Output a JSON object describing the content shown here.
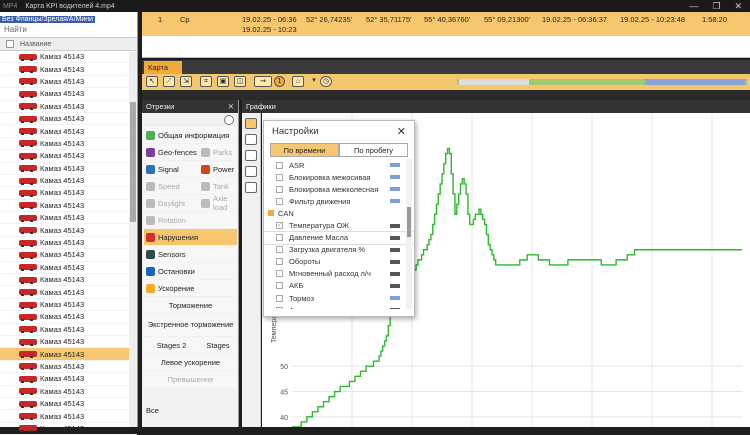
{
  "window": {
    "app": "MP4",
    "title": "Карта KPI водителей 4.mp4",
    "controls": [
      "—",
      "❐",
      "✕"
    ]
  },
  "vehicle_panel": {
    "overlay_text": "Без Фланцы/Зрелая/А/Мини",
    "search_placeholder": "Найти",
    "column_name": "Название",
    "rows": [
      "Камаз 45143",
      "Камаз 45143",
      "Камаз 45143",
      "Камаз 45143",
      "Камаз 45143",
      "Камаз 45143",
      "Камаз 45143",
      "Камаз 45143",
      "Камаз 45143",
      "Камаз 45143",
      "Камаз 45143",
      "Камаз 45143",
      "Камаз 45143",
      "Камаз 45143",
      "Камаз 45143",
      "Камаз 45143",
      "Камаз 45143",
      "Камаз 45143",
      "Камаз 45143",
      "Камаз 45143",
      "Камаз 45143",
      "Камаз 45143",
      "Камаз 45143",
      "Камаз 45143",
      "Камаз 45143",
      "Камаз 45143",
      "Камаз 45143",
      "Камаз 45143",
      "Камаз 45143",
      "Камаз 45143",
      "Камаз 45143"
    ],
    "selected_index": 24
  },
  "trip_row": {
    "number": "1",
    "type": "Ср",
    "period": "19.02.25 - 06:36",
    "period2": "19.02.25 - 10:23",
    "lat_start": "52° 26,74235'",
    "lat_end": "52° 35,71175'",
    "lon_start": "55° 40,36760'",
    "lon_end": "55° 09,21300'",
    "start_time": "19.02.25 - 06:36:37",
    "end_time": "19.02.25 - 10:23:48",
    "duration": "1:58:20"
  },
  "tabs": {
    "map": "Карта"
  },
  "toolbar": {
    "badge": "1"
  },
  "segments_panel": {
    "title": "Отрезки",
    "buttons": [
      {
        "label": "Общая информация",
        "color": "#4caf50",
        "wide": true,
        "dim": false
      },
      {
        "label": "Geo-fences",
        "color": "#7b3fa0",
        "wide": false,
        "dim": false
      },
      {
        "label": "Parks",
        "color": "#bbb",
        "wide": false,
        "dim": true
      },
      {
        "label": "Signal",
        "color": "#2e6fc0",
        "wide": false,
        "dim": false
      },
      {
        "label": "Power",
        "color": "#d84315",
        "wide": false,
        "dim": false
      },
      {
        "label": "Speed",
        "color": "#bbb",
        "wide": false,
        "dim": true
      },
      {
        "label": "Tank",
        "color": "#bbb",
        "wide": false,
        "dim": true
      },
      {
        "label": "Daylight",
        "color": "#bbb",
        "wide": false,
        "dim": true
      },
      {
        "label": "Axle load",
        "color": "#bbb",
        "wide": false,
        "dim": true
      },
      {
        "label": "Rotation",
        "color": "#bbb",
        "wide": true,
        "dim": true
      },
      {
        "label": "Нарушения",
        "color": "#d32f2f",
        "wide": true,
        "dim": false,
        "active": true
      },
      {
        "label": "Sensors",
        "color": "#37474f",
        "wide": true,
        "dim": false
      },
      {
        "label": "Остановки",
        "color": "#1565c0",
        "wide": true,
        "dim": false
      },
      {
        "label": "Ускорение",
        "color": "#f9a825",
        "wide": true,
        "dim": false
      },
      {
        "label": "Торможение",
        "plain": true,
        "wide": true
      },
      {
        "label": "Экстренное торможение",
        "plain": true,
        "wide": true,
        "two": true
      },
      {
        "label": "Stages 2",
        "plain": true,
        "wide": false
      },
      {
        "label": "Stages",
        "plain": true,
        "wide": false
      },
      {
        "label": "Левое ускорение",
        "plain": true,
        "wide": true
      },
      {
        "label": "Превышение",
        "plain": true,
        "wide": true,
        "dim": true
      }
    ],
    "footer": "Все"
  },
  "charts_panel": {
    "title": "Графики"
  },
  "settings_popup": {
    "title": "Настройки",
    "tab_time": "По времени",
    "tab_distance": "По пробегу",
    "items": [
      {
        "label": "ASR",
        "checked": false,
        "tag": "#7a9fd9"
      },
      {
        "label": "Блокировка межосивая",
        "checked": false,
        "tag": "#7a9fd9"
      },
      {
        "label": "Блокировка межколесная",
        "checked": false,
        "tag": "#7a9fd9"
      },
      {
        "label": "Фильтр движения",
        "checked": false,
        "tag": "#7a9fd9"
      },
      {
        "label": "CAN",
        "category": true
      },
      {
        "label": "Температура ОЖ",
        "checked": true,
        "tag": "#555"
      },
      {
        "label": "Давление Масла",
        "checked": false,
        "tag": "#555",
        "hover": true
      },
      {
        "label": "Загрузка двигателя %",
        "checked": false,
        "tag": "#555"
      },
      {
        "label": "Обороты",
        "checked": false,
        "tag": "#555"
      },
      {
        "label": "Мгновенный расход л/ч",
        "checked": false,
        "tag": "#555"
      },
      {
        "label": "АКБ",
        "checked": false,
        "tag": "#555"
      },
      {
        "label": "Тормоз",
        "checked": false,
        "tag": "#7a9fd9"
      },
      {
        "label": "Акселератор",
        "checked": false,
        "tag": "#555"
      }
    ]
  },
  "chart_data": {
    "type": "line",
    "ylabel": "Темпера",
    "yticks": [
      40,
      45,
      50
    ],
    "ylim": [
      38,
      100
    ],
    "color": "#2db82d",
    "series": [
      {
        "x": [
          0,
          8,
          10,
          14,
          16,
          20,
          22,
          26,
          28,
          32,
          34,
          38,
          40,
          44,
          46,
          50,
          52,
          56,
          58,
          62,
          64,
          68,
          70,
          74,
          76,
          80,
          82,
          86,
          88,
          92,
          94,
          96,
          98,
          100,
          102,
          104,
          106,
          110,
          112,
          116,
          118,
          122,
          124,
          128,
          130,
          134,
          136,
          140,
          142,
          146,
          148,
          150,
          152,
          154,
          156,
          158,
          160,
          162,
          164,
          166,
          168,
          170,
          172,
          174,
          176,
          178,
          180,
          182,
          184,
          186,
          188,
          190,
          192,
          196,
          198,
          202,
          204,
          206,
          208,
          210,
          212,
          214,
          216,
          218,
          220,
          222,
          224,
          226,
          228,
          230,
          234,
          238,
          242,
          246,
          250,
          254,
          258,
          262,
          266,
          270,
          274,
          278,
          282,
          286,
          290,
          294,
          298,
          302,
          306,
          310,
          314,
          318,
          322,
          326,
          330,
          334,
          338,
          342,
          346,
          350,
          354,
          358,
          362,
          366,
          370,
          374,
          378,
          382,
          386,
          390,
          394,
          398,
          402,
          406,
          410,
          414,
          418,
          422,
          426,
          430,
          434,
          438,
          442,
          446,
          450,
          454,
          458,
          462,
          466,
          470,
          474,
          478,
          482,
          486
        ],
        "y": [
          38,
          38,
          39,
          39,
          40,
          40,
          41,
          41,
          42,
          42,
          43,
          43,
          44,
          44,
          45,
          45,
          46,
          46,
          46,
          47,
          47,
          48,
          48,
          49,
          49,
          50,
          50,
          50,
          51,
          51,
          52,
          53,
          54,
          55,
          56,
          58,
          60,
          62,
          63,
          64,
          65,
          66,
          67,
          68,
          69,
          70,
          71,
          72,
          73,
          74,
          75,
          76,
          78,
          80,
          82,
          84,
          86,
          88,
          90,
          92,
          93,
          92,
          88,
          84,
          80,
          82,
          84,
          86,
          87,
          86,
          84,
          80,
          78,
          79,
          80,
          81,
          80,
          79,
          78,
          76,
          74,
          73,
          72,
          71,
          70,
          70,
          70,
          70,
          70,
          70,
          70,
          70,
          70,
          71,
          71,
          72,
          72,
          72,
          71,
          71,
          71,
          70,
          70,
          70,
          70,
          70,
          71,
          71,
          71,
          71,
          71,
          71,
          71,
          71,
          71,
          70,
          70,
          70,
          70,
          71,
          71,
          71,
          72,
          72,
          73,
          73,
          73,
          73,
          73,
          73,
          73,
          73,
          73,
          73,
          73,
          73,
          73,
          73,
          73,
          73,
          73,
          73,
          73,
          73,
          73,
          73,
          73,
          73,
          73,
          73,
          73,
          73,
          73,
          73
        ]
      }
    ]
  }
}
